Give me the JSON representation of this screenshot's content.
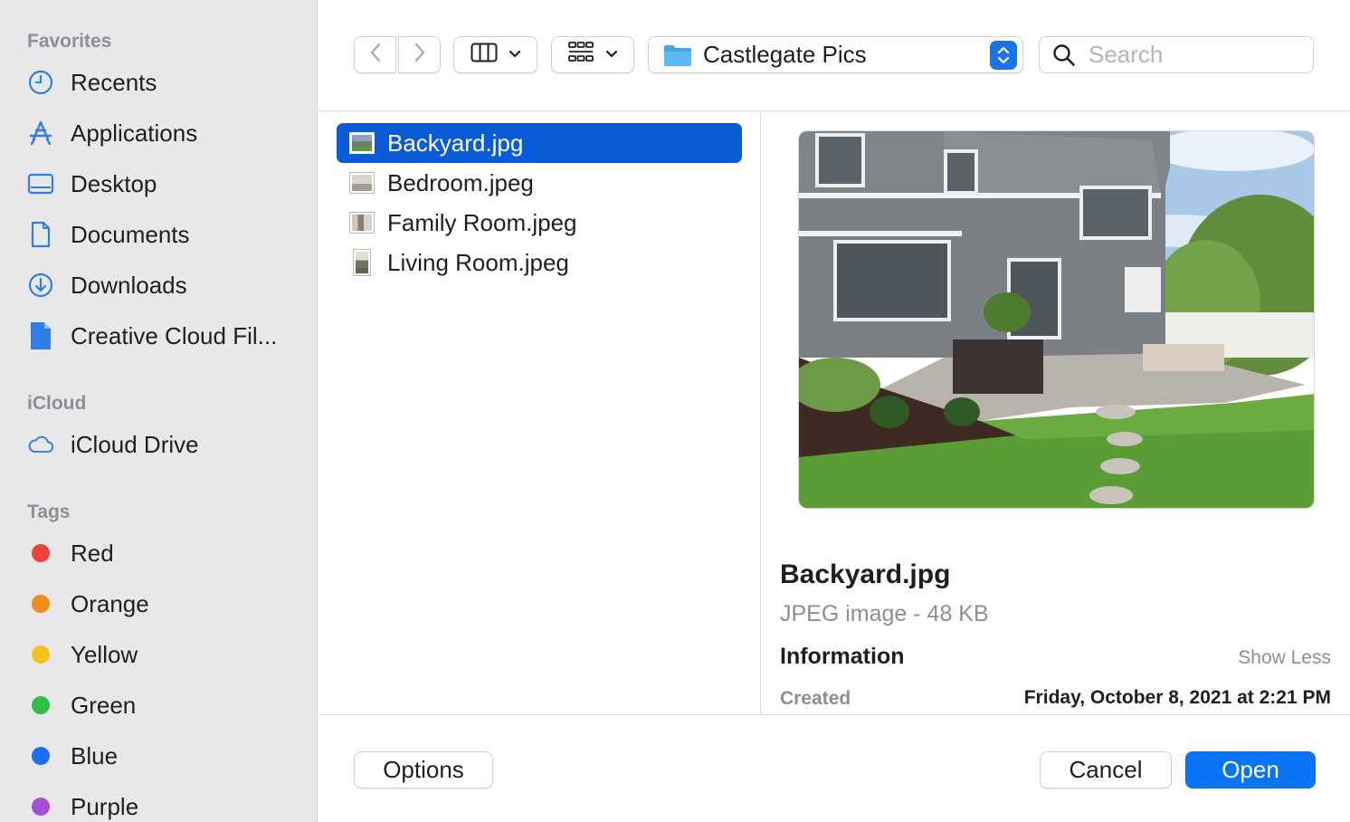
{
  "sidebar": {
    "favorites_heading": "Favorites",
    "favorites": [
      {
        "label": "Recents",
        "icon": "clock-icon"
      },
      {
        "label": "Applications",
        "icon": "applications-icon"
      },
      {
        "label": "Desktop",
        "icon": "desktop-icon"
      },
      {
        "label": "Documents",
        "icon": "document-icon"
      },
      {
        "label": "Downloads",
        "icon": "download-icon"
      },
      {
        "label": "Creative Cloud Fil...",
        "icon": "file-icon"
      }
    ],
    "icloud_heading": "iCloud",
    "icloud": [
      {
        "label": "iCloud Drive",
        "icon": "cloud-icon"
      }
    ],
    "tags_heading": "Tags",
    "tags": [
      {
        "label": "Red",
        "color": "#f0413a"
      },
      {
        "label": "Orange",
        "color": "#f28a1c"
      },
      {
        "label": "Yellow",
        "color": "#f2c31a"
      },
      {
        "label": "Green",
        "color": "#2fbf47"
      },
      {
        "label": "Blue",
        "color": "#1a6ff2"
      },
      {
        "label": "Purple",
        "color": "#a350d6"
      }
    ]
  },
  "toolbar": {
    "back_icon": "chevron-left-icon",
    "forward_icon": "chevron-right-icon",
    "view_mode_icon": "columns-icon",
    "group_icon": "grid-icon",
    "current_folder": "Castlegate Pics",
    "search_placeholder": "Search"
  },
  "files": [
    {
      "name": "Backyard.jpg",
      "selected": true
    },
    {
      "name": "Bedroom.jpeg",
      "selected": false
    },
    {
      "name": "Family Room.jpeg",
      "selected": false
    },
    {
      "name": "Living Room.jpeg",
      "selected": false
    }
  ],
  "preview": {
    "name": "Backyard.jpg",
    "kind": "JPEG image - 48 KB",
    "info_heading": "Information",
    "show_less": "Show Less",
    "created_label": "Created",
    "created_value": "Friday, October 8, 2021 at 2:21 PM"
  },
  "footer": {
    "options_label": "Options",
    "cancel_label": "Cancel",
    "open_label": "Open"
  },
  "colors": {
    "accent": "#0a74f5",
    "selection": "#0a5bd6",
    "sidebar_bg": "#e8e8ea",
    "icon_blue": "#2f7ee8"
  }
}
